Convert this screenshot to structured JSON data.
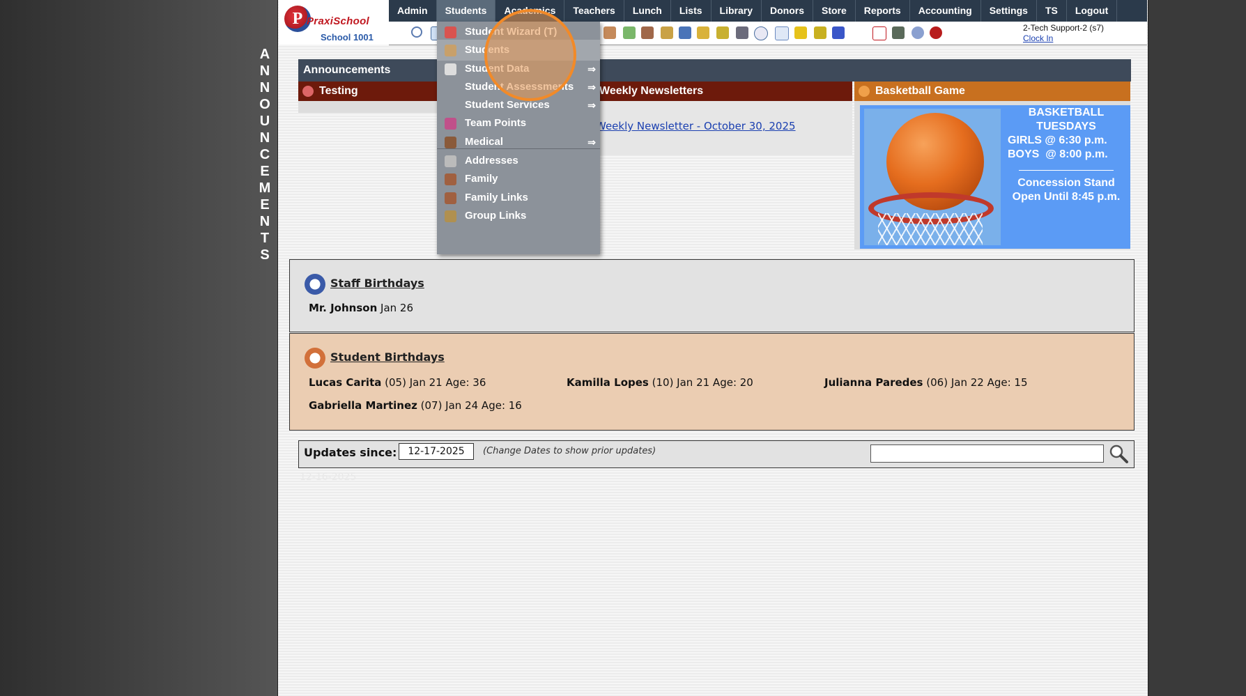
{
  "sidebar_letters": [
    "A",
    "N",
    "N",
    "O",
    "U",
    "N",
    "C",
    "E",
    "M",
    "E",
    "N",
    "T",
    "S"
  ],
  "logo": {
    "brand": "PraxiSchool",
    "school": "School 1001"
  },
  "nav": [
    "Admin",
    "Students",
    "Academics",
    "Teachers",
    "Lunch",
    "Lists",
    "Library",
    "Donors",
    "Store",
    "Reports",
    "Accounting",
    "Settings",
    "TS",
    "Logout"
  ],
  "nav_active": "Students",
  "user": {
    "name": "2-Tech Support-2 (s7)",
    "clock_in": "Clock In"
  },
  "announcements": {
    "header": "Announcements",
    "testing": "Testing",
    "newsletters": "Weekly Newsletters",
    "newsletter_link": "Weekly Newsletter - October 30, 2025",
    "basketball": {
      "title": "Basketball Game",
      "line1": "BASKETBALL",
      "line2": "TUESDAYS",
      "line3": "GIRLS @ 6:30 p.m.",
      "line4": "BOYS  @ 8:00 p.m.",
      "line5": "Concession Stand",
      "line6": "Open Until 8:45 p.m."
    }
  },
  "staff_birthdays": {
    "title": "Staff Birthdays",
    "entries": [
      {
        "name": "Mr. Johnson",
        "detail": " Jan 26"
      }
    ]
  },
  "student_birthdays": {
    "title": "Student Birthdays",
    "entries": [
      {
        "name": "Lucas Carita",
        "detail": " (05) Jan 21 Age: 36"
      },
      {
        "name": "Kamilla Lopes",
        "detail": " (10) Jan 21 Age: 20"
      },
      {
        "name": "Julianna Paredes",
        "detail": " (06) Jan 22 Age: 15"
      },
      {
        "name": "Gabriella Martinez",
        "detail": " (07) Jan 24 Age: 16"
      }
    ]
  },
  "updates": {
    "label": "Updates since:",
    "date": "12-17-2025",
    "hint": "(Change Dates to show prior updates)",
    "faded": "12-16-2025"
  },
  "dropdown": [
    {
      "label": "Student Wizard (T)",
      "arrow": "",
      "icon": "wizard-icon",
      "color": "#d9534f"
    },
    {
      "label": "Students",
      "arrow": "",
      "icon": "student-icon",
      "color": "#c8a06a"
    },
    {
      "label": "Student Data",
      "arrow": "⇒",
      "icon": "data-icon",
      "color": "#ddd"
    },
    {
      "label": "Student Assessments",
      "arrow": "⇒",
      "icon": "",
      "color": ""
    },
    {
      "label": "Student Services",
      "arrow": "⇒",
      "icon": "",
      "color": ""
    },
    {
      "label": "Team Points",
      "arrow": "",
      "icon": "team-points-icon",
      "color": "#c0508a"
    },
    {
      "label": "Medical",
      "arrow": "⇒",
      "icon": "medical-icon",
      "color": "#8a5a3a"
    },
    {
      "label": "Addresses",
      "arrow": "",
      "icon": "address-icon",
      "color": "#bbb"
    },
    {
      "label": "Family",
      "arrow": "",
      "icon": "family-icon",
      "color": "#a06040"
    },
    {
      "label": "Family Links",
      "arrow": "",
      "icon": "family-links-icon",
      "color": "#a06040"
    },
    {
      "label": "Group Links",
      "arrow": "",
      "icon": "group-links-icon",
      "color": "#b09050"
    }
  ]
}
